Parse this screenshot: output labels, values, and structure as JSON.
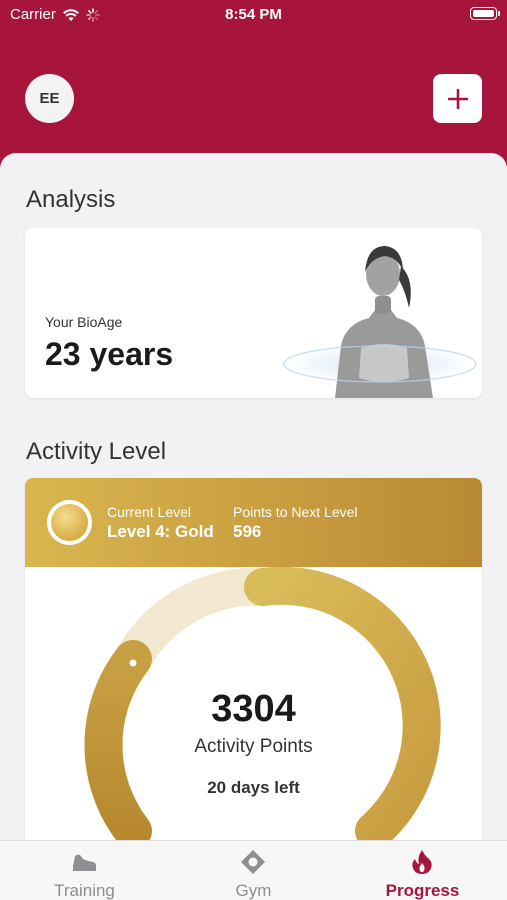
{
  "status_bar": {
    "carrier": "Carrier",
    "time": "8:54 PM"
  },
  "header": {
    "avatar_initials": "EE",
    "add_icon": "plus-icon"
  },
  "analysis": {
    "title": "Analysis",
    "bioage_label": "Your BioAge",
    "bioage_value": "23 years"
  },
  "activity": {
    "title": "Activity Level",
    "current_level_label": "Current Level",
    "current_level_value": "Level 4: Gold",
    "points_next_label": "Points to Next Level",
    "points_next_value": "596",
    "points": "3304",
    "points_label": "Activity Points",
    "days_left": "20 days left"
  },
  "tabs": [
    {
      "label": "Training",
      "icon": "shoe-icon",
      "active": false
    },
    {
      "label": "Gym",
      "icon": "location-pin-icon",
      "active": false
    },
    {
      "label": "Progress",
      "icon": "flame-icon",
      "active": true
    }
  ],
  "colors": {
    "brand": "#a8153c",
    "gold": "#c89c3f",
    "tab_inactive": "#8e8e93"
  }
}
